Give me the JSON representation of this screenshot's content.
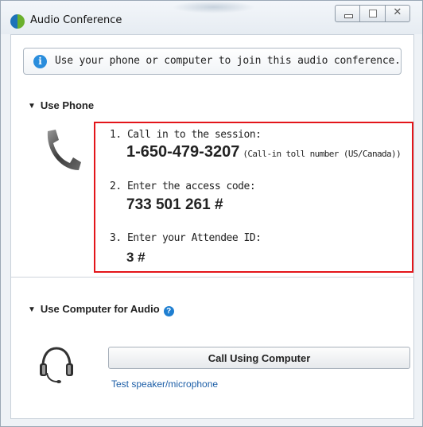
{
  "window": {
    "title": "Audio Conference",
    "controls": [
      "minimize-icon",
      "maximize-icon",
      "close-icon"
    ]
  },
  "info": {
    "text": "Use your phone or computer to join this audio conference.",
    "icon": "info-icon"
  },
  "phone_section": {
    "header": "Use Phone",
    "icon": "phone-handset-icon",
    "steps": [
      {
        "label": "1. Call in to the session:",
        "value": "1-650-479-3207",
        "note": "(Call-in toll number (US/Canada))"
      },
      {
        "label": "2. Enter the access code:",
        "value": "733 501 261 #"
      },
      {
        "label": "3. Enter your Attendee ID:",
        "value": "3 #"
      }
    ],
    "highlight_color": "#e3151a"
  },
  "computer_section": {
    "header": "Use Computer for Audio",
    "help_icon": "help-icon",
    "icon": "headset-icon",
    "call_button": "Call Using Computer",
    "test_link": "Test speaker/microphone"
  },
  "colors": {
    "accent": "#2a8ddc",
    "link": "#1c5ea7",
    "highlight": "#e3151a"
  }
}
